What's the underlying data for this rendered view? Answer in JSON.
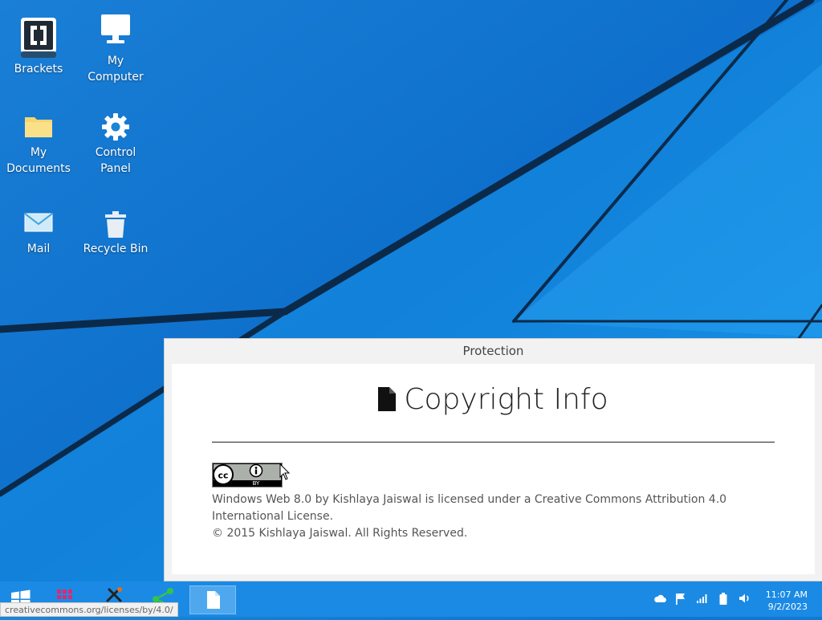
{
  "desktop": {
    "icons": [
      {
        "label": "Brackets",
        "icon": "brackets-icon"
      },
      {
        "label": "My\nComputer",
        "icon": "monitor-icon"
      },
      {
        "label": "My\nDocuments",
        "icon": "folder-icon"
      },
      {
        "label": "Control\nPanel",
        "icon": "gear-icon"
      },
      {
        "label": "Mail",
        "icon": "mail-icon"
      },
      {
        "label": "Recycle Bin",
        "icon": "trash-icon"
      }
    ]
  },
  "dialog": {
    "title": "Protection",
    "heading": "Copyright Info",
    "badge_left": "BY",
    "license_line": "Windows Web 8.0 by Kishlaya Jaiswal is licensed under a Creative Commons Attribution 4.0 International License.",
    "copyright_line": "© 2015 Kishlaya Jaiswal. All Rights Reserved."
  },
  "taskbar": {
    "apps": [
      "windows-start-icon",
      "apps-grid-icon",
      "tools-icon",
      "share-icon",
      "document-icon"
    ],
    "tray": [
      "cloud-icon",
      "flag-icon",
      "signal-icon",
      "battery-icon",
      "volume-icon"
    ],
    "time": "11:07 AM",
    "date": "9/2/2023"
  },
  "status_url": "creativecommons.org/licenses/by/4.0/",
  "colors": {
    "desktop": "#1a86d8",
    "taskbar": "#1b8ae4",
    "dialog_bg": "#f2f2f2"
  }
}
